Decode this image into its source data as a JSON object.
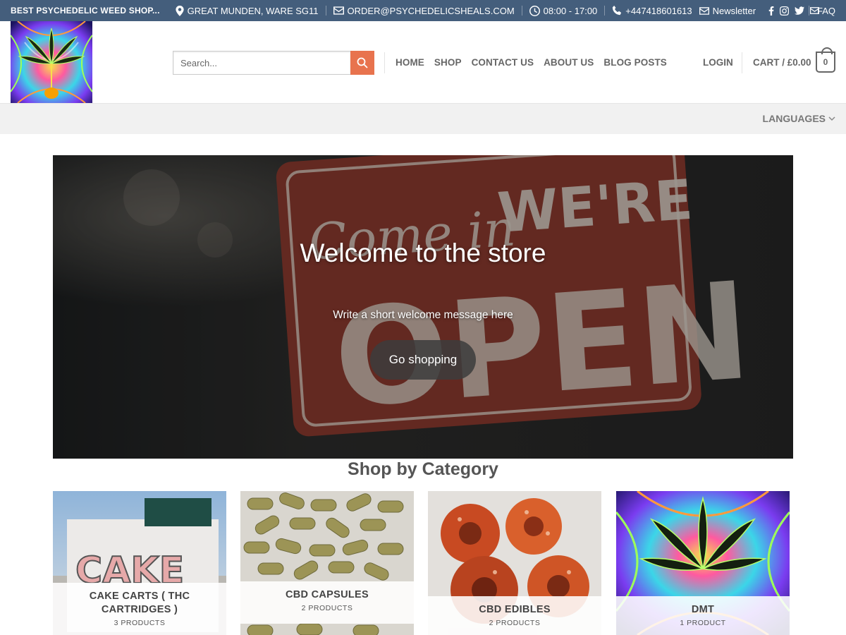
{
  "topbar": {
    "brand": "BEST PSYCHEDELIC WEED SHOP...",
    "location": "GREAT MUNDEN, WARE SG11",
    "email": "ORDER@PSYCHEDELICSHEALS.COM",
    "hours": "08:00 - 17:00",
    "phone": "+447418601613",
    "newsletter": "Newsletter",
    "faq": "FAQ"
  },
  "header": {
    "search_placeholder": "Search...",
    "nav": [
      "HOME",
      "SHOP",
      "CONTACT US",
      "ABOUT US",
      "BLOG POSTS"
    ],
    "login": "LOGIN",
    "cart": "CART / £0.00",
    "cart_count": "0"
  },
  "subbar": {
    "languages": "LANGUAGES"
  },
  "hero": {
    "title": "Welcome to the store",
    "subtitle": "Write a short welcome message here",
    "button": "Go shopping",
    "sign_script": "Come in",
    "sign_top": "WE'RE",
    "sign_big": "OPEN"
  },
  "categories": {
    "title": "Shop by Category",
    "items": [
      {
        "name": "CAKE CARTS ( THC CARTRIDGES )",
        "count": "3 PRODUCTS",
        "image_text": "CAKE"
      },
      {
        "name": "CBD CAPSULES",
        "count": "2 PRODUCTS"
      },
      {
        "name": "CBD EDIBLES",
        "count": "2 PRODUCTS"
      },
      {
        "name": "DMT",
        "count": "1 PRODUCT"
      }
    ]
  },
  "colors": {
    "topbar": "#445e7c",
    "accent": "#e8734e",
    "text": "#666666"
  }
}
